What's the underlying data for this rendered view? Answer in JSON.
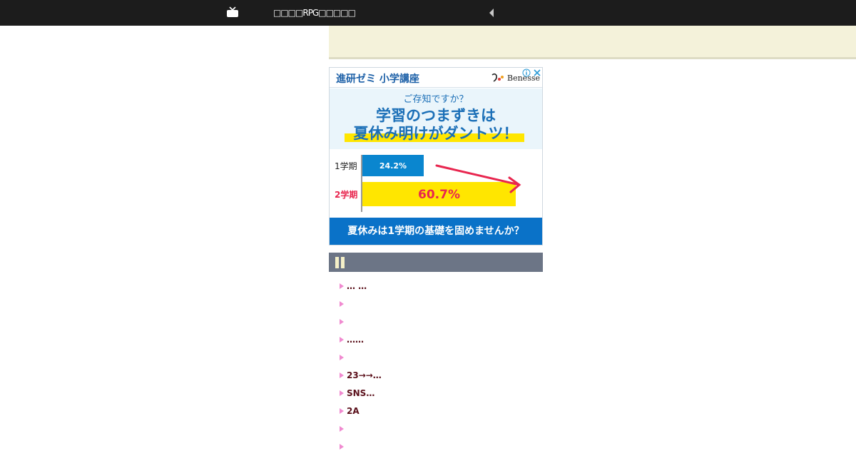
{
  "header": {
    "site_title": "□□□□RPG□□□□□",
    "colors": {
      "bar": "#1c1c1c"
    },
    "icons": {
      "left": "tv-icon",
      "right": "back-arrow-icon"
    }
  },
  "ad": {
    "brand": "進研ゼミ 小学講座",
    "logo_text": "Benesse",
    "question": "ご存知ですか？",
    "headline_line1": "学習のつまずきは",
    "headline_line2": "夏休み明けがダントツ！",
    "chart_data": {
      "type": "bar",
      "categories": [
        "1学期",
        "2学期"
      ],
      "values": [
        24.2,
        60.7
      ],
      "value_labels": [
        "24.2%",
        "60.7%"
      ],
      "colors": [
        "#0a86cf",
        "#ffe600"
      ]
    },
    "cta": "夏休みは1学期の基礎を固めませんか？"
  },
  "links": [
    "… …",
    "",
    "",
    "……",
    "",
    "23→→…",
    " SNS…",
    "2A",
    "",
    ""
  ]
}
